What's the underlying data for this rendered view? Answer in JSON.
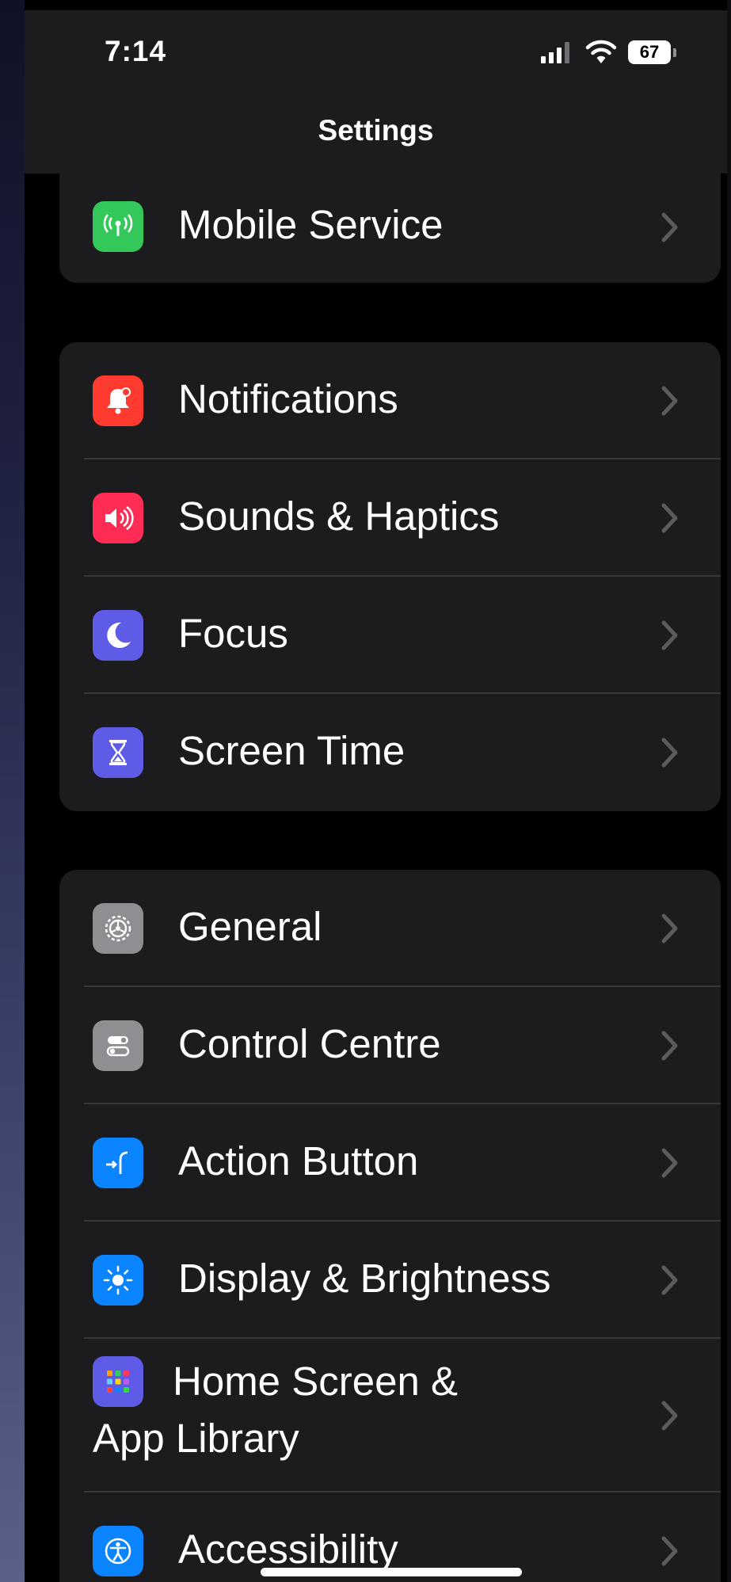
{
  "status_bar": {
    "time": "7:14",
    "battery": "67"
  },
  "nav": {
    "title": "Settings"
  },
  "groups": [
    {
      "rows": [
        {
          "label": "Mobile Service",
          "icon": "antenna-icon",
          "color": "#34c759"
        }
      ]
    },
    {
      "rows": [
        {
          "label": "Notifications",
          "icon": "bell-icon",
          "color": "#ff3b30"
        },
        {
          "label": "Sounds & Haptics",
          "icon": "speaker-icon",
          "color": "#ff2d55"
        },
        {
          "label": "Focus",
          "icon": "moon-icon",
          "color": "#5e5ce6"
        },
        {
          "label": "Screen Time",
          "icon": "hourglass-icon",
          "color": "#5e5ce6"
        }
      ]
    },
    {
      "rows": [
        {
          "label": "General",
          "icon": "gear-icon",
          "color": "#8e8e93"
        },
        {
          "label": "Control Centre",
          "icon": "toggles-icon",
          "color": "#8e8e93"
        },
        {
          "label": "Action Button",
          "icon": "action-button-icon",
          "color": "#0a84ff"
        },
        {
          "label": "Display & Brightness",
          "icon": "sun-icon",
          "color": "#0a84ff"
        },
        {
          "label": "Home Screen & App Library",
          "icon": "app-grid-icon",
          "color": "#5e5ce6"
        },
        {
          "label": "Accessibility",
          "icon": "accessibility-icon",
          "color": "#0a84ff"
        }
      ]
    }
  ]
}
